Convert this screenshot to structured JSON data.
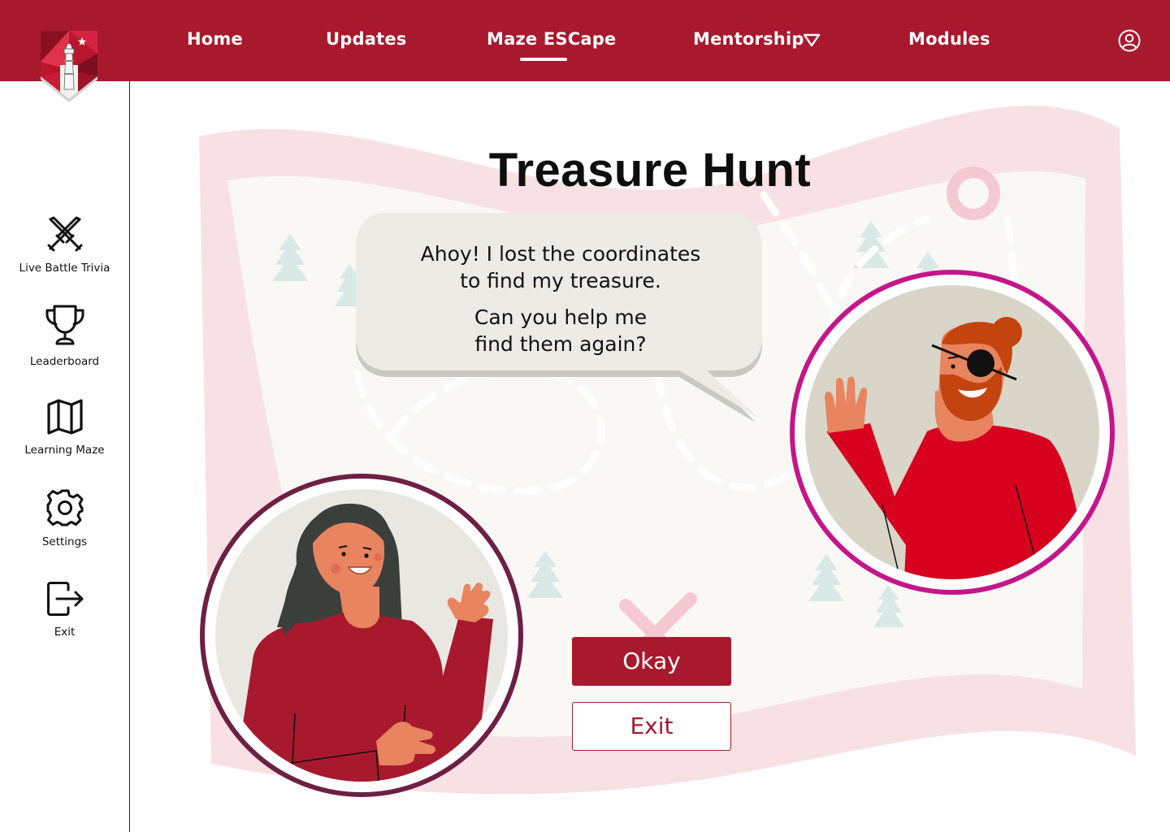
{
  "app": {
    "logo": "University crest logo with lighthouse",
    "brand_color": "#a8192e"
  },
  "nav": {
    "items": [
      {
        "label": "Home"
      },
      {
        "label": "Updates"
      },
      {
        "label": "Maze ESCape",
        "active": true
      },
      {
        "label": "Mentorship",
        "has_dropdown": true
      },
      {
        "label": "Modules"
      }
    ],
    "profile_icon": "user-circle-icon"
  },
  "sidebar": {
    "items": [
      {
        "label": "Live Battle Trivia",
        "icon": "crossed-swords-icon"
      },
      {
        "label": "Leaderboard",
        "icon": "trophy-icon"
      },
      {
        "label": "Learning Maze",
        "icon": "map-icon"
      },
      {
        "label": "Settings",
        "icon": "gear-icon"
      },
      {
        "label": "Exit",
        "icon": "exit-icon"
      }
    ]
  },
  "main": {
    "title": "Treasure Hunt",
    "dialog": {
      "line1": "Ahoy! I lost the coordinates",
      "line2": "to find my treasure.",
      "line3": "Can you help me",
      "line4": "find them again?"
    },
    "buttons": {
      "okay": "Okay",
      "exit": "Exit"
    }
  },
  "colors": {
    "nav_bg": "#a8192e",
    "woman_ring": "#6e1f44",
    "pirate_ring": "#c4168a",
    "bubble": "#ecebe6",
    "map_pink": "#f8e1e5"
  }
}
